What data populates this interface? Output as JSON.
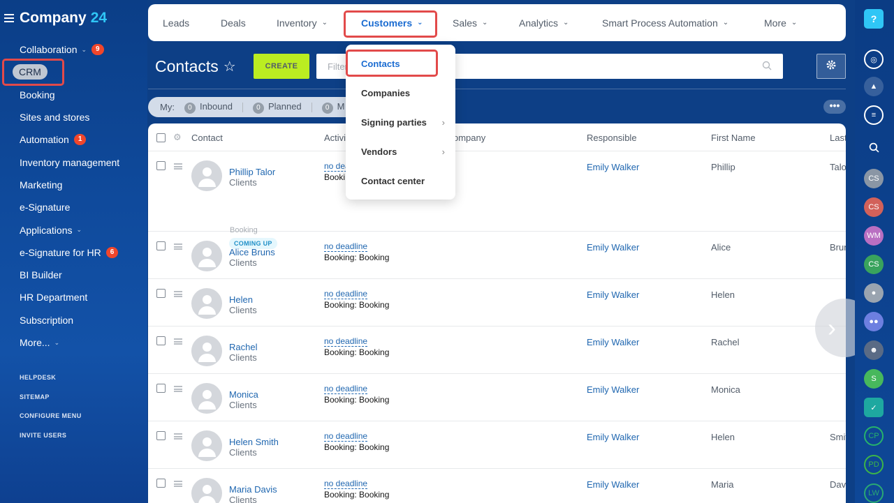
{
  "sidebar": {
    "logo_name": "Company",
    "logo_number": "24",
    "items": [
      {
        "label": "Collaboration",
        "badge": "9",
        "chevron": true
      },
      {
        "label": "CRM"
      },
      {
        "label": "Booking"
      },
      {
        "label": "Sites and stores"
      },
      {
        "label": "Automation",
        "badge": "1"
      },
      {
        "label": "Inventory management"
      },
      {
        "label": "Marketing"
      },
      {
        "label": "e-Signature"
      },
      {
        "label": "Applications",
        "chevron": true
      },
      {
        "label": "e-Signature for HR",
        "badge": "6"
      },
      {
        "label": "BI Builder"
      },
      {
        "label": "HR Department"
      },
      {
        "label": "Subscription"
      },
      {
        "label": "More...",
        "chevron": true
      }
    ],
    "bottom_links": [
      "HELPDESK",
      "SITEMAP",
      "CONFIGURE MENU",
      "INVITE USERS"
    ]
  },
  "topnav": {
    "items": [
      {
        "label": "Leads"
      },
      {
        "label": "Deals"
      },
      {
        "label": "Inventory"
      },
      {
        "label": "Customers"
      },
      {
        "label": "Sales"
      },
      {
        "label": "Analytics"
      },
      {
        "label": "Smart Process Automation"
      },
      {
        "label": "More"
      }
    ]
  },
  "dropdown": {
    "items": [
      {
        "label": "Contacts"
      },
      {
        "label": "Companies"
      },
      {
        "label": "Signing parties"
      },
      {
        "label": "Vendors"
      },
      {
        "label": "Contact center"
      }
    ]
  },
  "header": {
    "title": "Contacts",
    "create_label": "CREATE",
    "filter_placeholder": "Filter + search"
  },
  "counters": {
    "my_label": "My:",
    "items": [
      {
        "count": "0",
        "label": "Inbound"
      },
      {
        "count": "0",
        "label": "Planned"
      },
      {
        "count": "0",
        "label": "M"
      }
    ]
  },
  "grid": {
    "columns": [
      "Contact",
      "Activi",
      "ompany",
      "Responsible",
      "First Name",
      "Last"
    ],
    "rows": [
      {
        "name": "Phillip Talor",
        "type": "Clients",
        "activity": "no dea",
        "activity_sub": "Booki",
        "responsible": "Emily Walker",
        "first": "Phillip",
        "last": "Talo",
        "booking_label": "Booking",
        "tag": "COMING UP"
      },
      {
        "name": "Alice Bruns",
        "type": "Clients",
        "activity": "no deadline",
        "activity_sub": "Booking: Booking",
        "responsible": "Emily Walker",
        "first": "Alice",
        "last": "Brun"
      },
      {
        "name": "Helen",
        "type": "Clients",
        "activity": "no deadline",
        "activity_sub": "Booking: Booking",
        "responsible": "Emily Walker",
        "first": "Helen",
        "last": ""
      },
      {
        "name": "Rachel",
        "type": "Clients",
        "activity": "no deadline",
        "activity_sub": "Booking: Booking",
        "responsible": "Emily Walker",
        "first": "Rachel",
        "last": ""
      },
      {
        "name": "Monica",
        "type": "Clients",
        "activity": "no deadline",
        "activity_sub": "Booking: Booking",
        "responsible": "Emily Walker",
        "first": "Monica",
        "last": ""
      },
      {
        "name": "Helen Smith",
        "type": "Clients",
        "activity": "no deadline",
        "activity_sub": "Booking: Booking",
        "responsible": "Emily Walker",
        "first": "Helen",
        "last": "Smit"
      },
      {
        "name": "Maria Davis",
        "type": "Clients",
        "activity": "no deadline",
        "activity_sub": "Booking: Booking",
        "responsible": "Emily Walker",
        "first": "Maria",
        "last": "Davi"
      }
    ]
  },
  "rightrail": {
    "avatars": [
      {
        "initials": "CS",
        "color": "#8a96a5"
      },
      {
        "initials": "CS",
        "color": "#d2615a"
      },
      {
        "initials": "WM",
        "color": "#b96fc2"
      },
      {
        "initials": "CS",
        "color": "#39a35d"
      },
      {
        "initials": "S",
        "color": "#47b85c"
      },
      {
        "initials": "CP",
        "color": "#27b36b"
      },
      {
        "initials": "PD",
        "color": "#3db548"
      },
      {
        "initials": "LW",
        "color": "#2aa874"
      }
    ]
  },
  "colors": {
    "accent": "#1b6cd1",
    "create": "#bbed21",
    "badge": "#f0462b",
    "highlight": "#e24a4a"
  }
}
